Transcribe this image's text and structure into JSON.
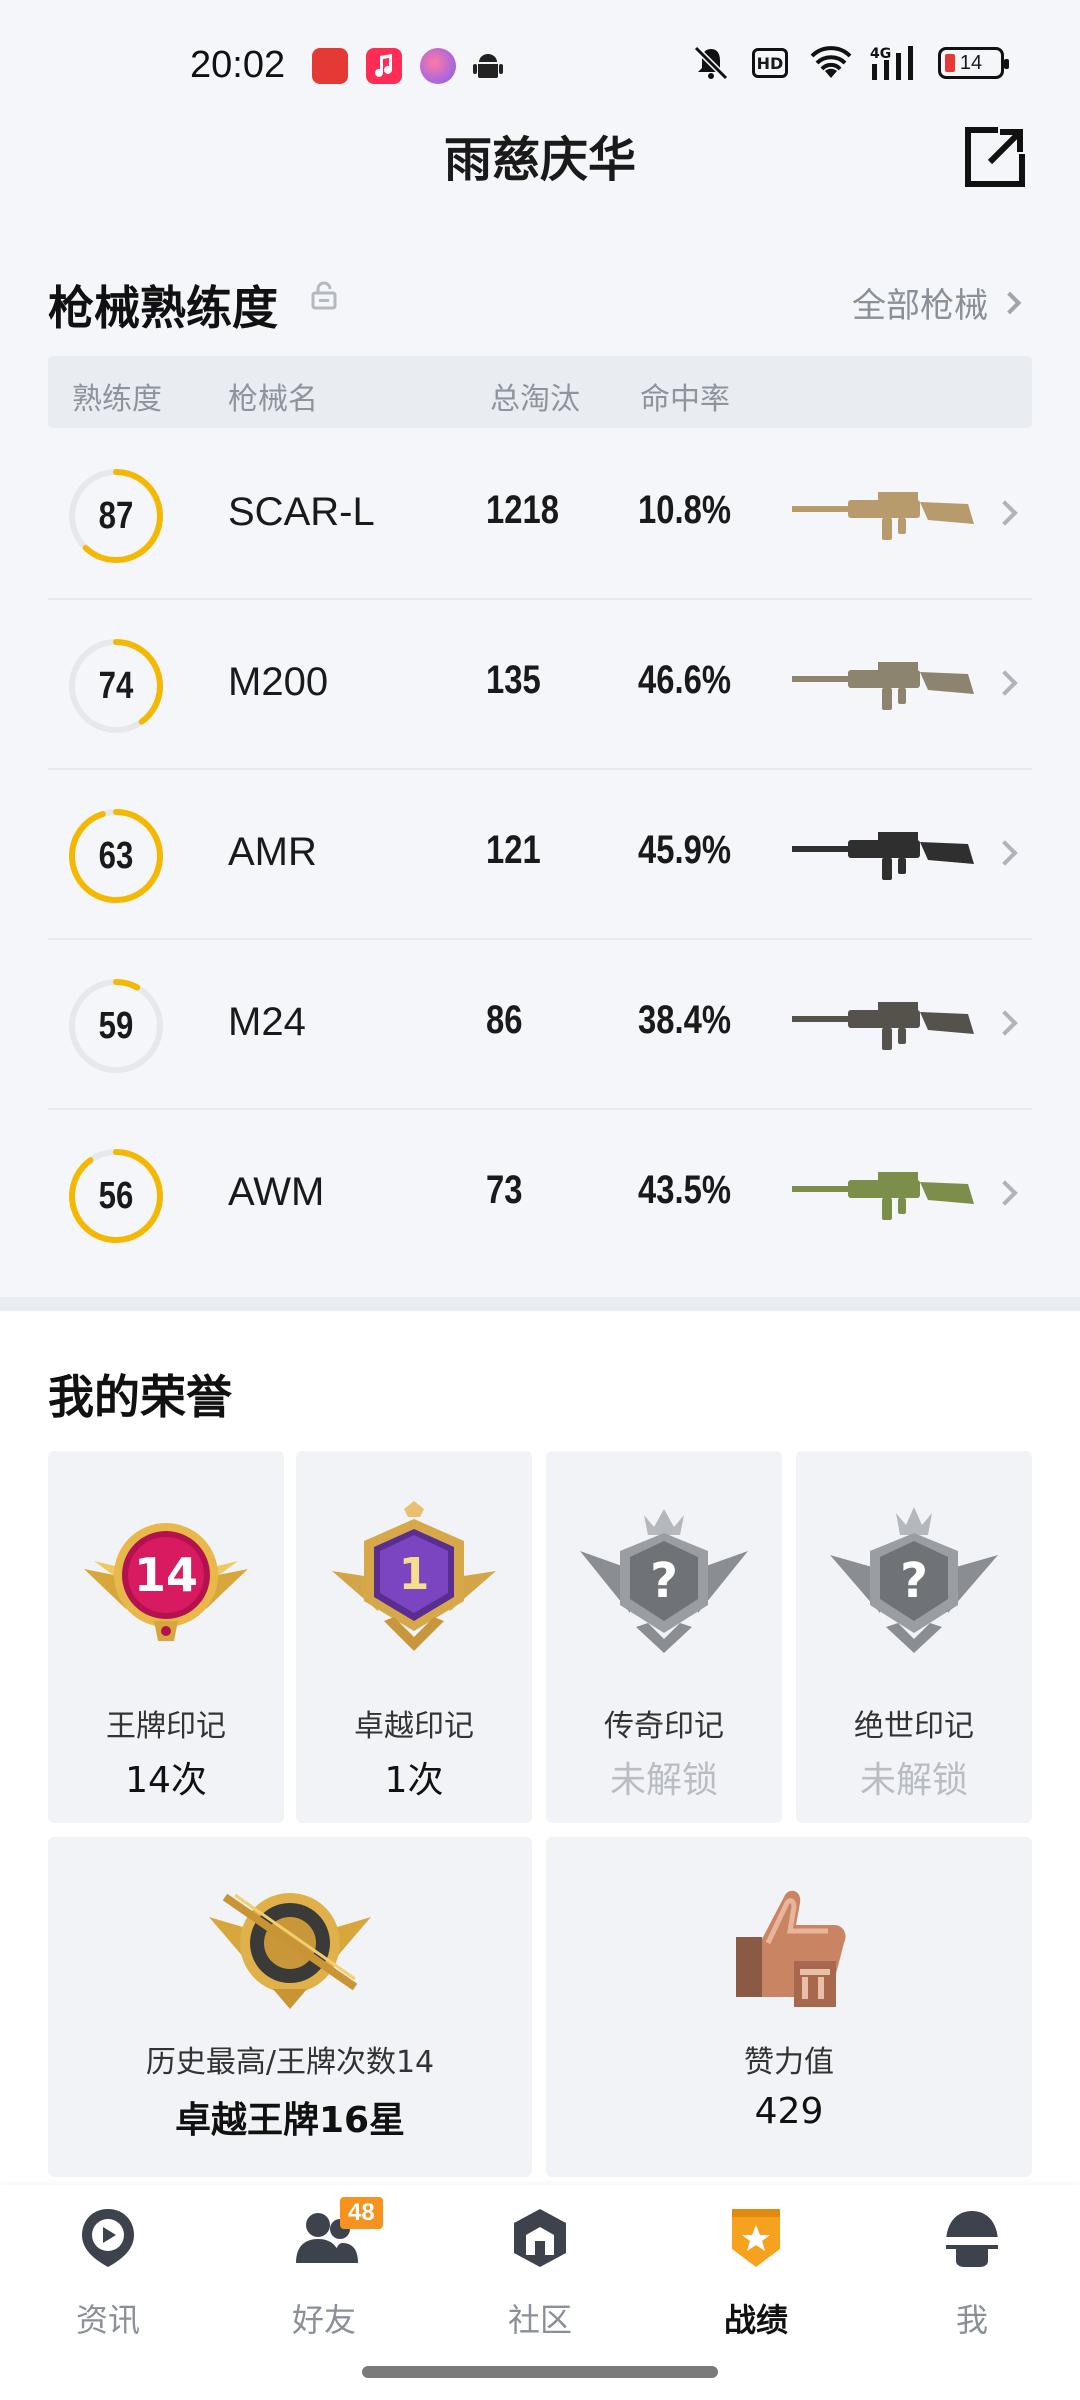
{
  "status_bar": {
    "time": "20:02",
    "network": "4G",
    "battery": "14",
    "hd_label": "HD",
    "icons": [
      "app-notification-icon",
      "music-app-icon",
      "photo-app-icon",
      "android-icon",
      "mute-icon",
      "hd-icon",
      "wifi-icon",
      "signal-icon",
      "battery-icon"
    ]
  },
  "header": {
    "title": "雨慈庆华",
    "share_icon": "share-external-icon"
  },
  "weapons": {
    "title": "枪械熟练度",
    "all_link": "全部枪械",
    "columns": [
      "熟练度",
      "枪械名",
      "总淘汰",
      "命中率"
    ],
    "items": [
      {
        "proficiency": "87",
        "progress": 0.62,
        "name": "SCAR-L",
        "kills": "1218",
        "hit_rate": "10.8%",
        "gun_color": "#b89b6d"
      },
      {
        "proficiency": "74",
        "progress": 0.4,
        "name": "M200",
        "kills": "135",
        "hit_rate": "46.6%",
        "gun_color": "#8d8470"
      },
      {
        "proficiency": "63",
        "progress": 0.95,
        "name": "AMR",
        "kills": "121",
        "hit_rate": "45.9%",
        "gun_color": "#2f2f2f"
      },
      {
        "proficiency": "59",
        "progress": 0.08,
        "name": "M24",
        "kills": "86",
        "hit_rate": "38.4%",
        "gun_color": "#55524c"
      },
      {
        "proficiency": "56",
        "progress": 0.9,
        "name": "AWM",
        "kills": "73",
        "hit_rate": "43.5%",
        "gun_color": "#7c8f4a"
      }
    ],
    "ring_color": "#f5b800"
  },
  "honors": {
    "title": "我的荣誉",
    "marks": [
      {
        "label": "王牌印记",
        "value": "14次",
        "badge_text": "14",
        "locked": false
      },
      {
        "label": "卓越印记",
        "value": "1次",
        "badge_text": "1",
        "locked": false
      },
      {
        "label": "传奇印记",
        "value": "未解锁",
        "badge_text": "?",
        "locked": true
      },
      {
        "label": "绝世印记",
        "value": "未解锁",
        "badge_text": "?",
        "locked": true
      }
    ],
    "history": {
      "label": "历史最高/王牌次数14",
      "value": "卓越王牌16星"
    },
    "likes": {
      "label": "赞力值",
      "value": "429"
    }
  },
  "nav": {
    "items": [
      {
        "label": "资讯",
        "icon": "news-play-icon",
        "active": false
      },
      {
        "label": "好友",
        "icon": "friends-icon",
        "active": false,
        "badge": "48"
      },
      {
        "label": "社区",
        "icon": "community-icon",
        "active": false
      },
      {
        "label": "战绩",
        "icon": "record-shield-icon",
        "active": true
      },
      {
        "label": "我",
        "icon": "helmet-profile-icon",
        "active": false
      }
    ],
    "accent": "#f6a21e"
  }
}
